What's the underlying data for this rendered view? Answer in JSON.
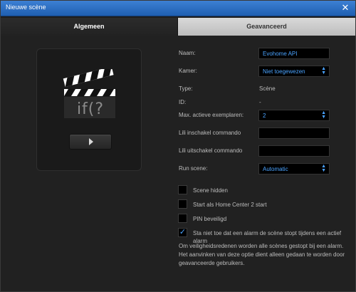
{
  "window": {
    "title": "Nieuwe scène",
    "close_glyph": "✕"
  },
  "tabs": [
    {
      "label": "Algemeen",
      "active": true
    },
    {
      "label": "Geavanceerd",
      "active": false
    }
  ],
  "preview": {
    "icon": "clapperboard-icon",
    "text": "if(?",
    "play_icon": "play-icon"
  },
  "form": {
    "naam": {
      "label": "Naam:",
      "value": "Evohome API"
    },
    "kamer": {
      "label": "Kamer:",
      "value": "Niet toegewezen"
    },
    "type": {
      "label": "Type:",
      "value": "Scène"
    },
    "id": {
      "label": "ID:",
      "value": "-"
    },
    "max": {
      "label": "Max. actieve exemplaren:",
      "value": "2"
    },
    "lili_in": {
      "label": "Lili inschakel commando",
      "value": ""
    },
    "lili_uit": {
      "label": "Lili uitschakel commando",
      "value": ""
    },
    "run": {
      "label": "Run scene:",
      "value": "Automatic"
    }
  },
  "checkboxes": [
    {
      "label": "Scene hidden",
      "checked": false
    },
    {
      "label": "Start als Home Center 2 start",
      "checked": false
    },
    {
      "label": "PIN beveiligd",
      "checked": false
    },
    {
      "label": "Sta niet toe dat een alarm de scène stopt tijdens een actief alarm",
      "checked": true
    }
  ],
  "info_text": "Om veiligheidsredenen worden alle scènes gestopt bij een alarm. Het aanvinken van deze optie dient alleen gedaan te worden door geavanceerde gebruikers.",
  "colors": {
    "titlebar": "#2b6cc4",
    "accent": "#4aa3ff"
  }
}
